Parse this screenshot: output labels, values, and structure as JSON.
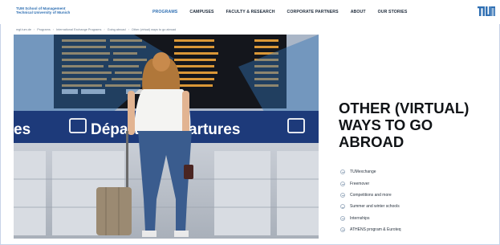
{
  "header": {
    "logo_lines": [
      "TUM School of Management",
      "Technical University of Munich"
    ],
    "nav": [
      "PROGRAMS",
      "CAMPUSES",
      "FACULTY & RESEARCH",
      "CORPORATE PARTNERS",
      "ABOUT",
      "OUR STORIES"
    ],
    "active_nav": "PROGRAMS",
    "brand_mark": "TUM"
  },
  "breadcrumb": [
    "mgt.tum.de",
    "Programs",
    "International Exchange Programs",
    "Going abroad",
    "Other (virtual) ways to go abroad"
  ],
  "hero": {
    "image_subject": "woman-with-suitcase-at-departures-board",
    "sign_left": "Départs",
    "sign_right": "artures",
    "sign_edge": "es"
  },
  "main": {
    "title_lines": [
      "OTHER (VIRTUAL)",
      "WAYS TO GO",
      "ABROAD"
    ],
    "links": [
      "TUMexchange",
      "Freemover",
      "Competitions and more",
      "Summer and winter schools",
      "Internships",
      "ATHENS program & Euroteq"
    ]
  },
  "colors": {
    "accent": "#3070b3",
    "text": "#111417",
    "sign_blue": "#1d3a7a"
  }
}
